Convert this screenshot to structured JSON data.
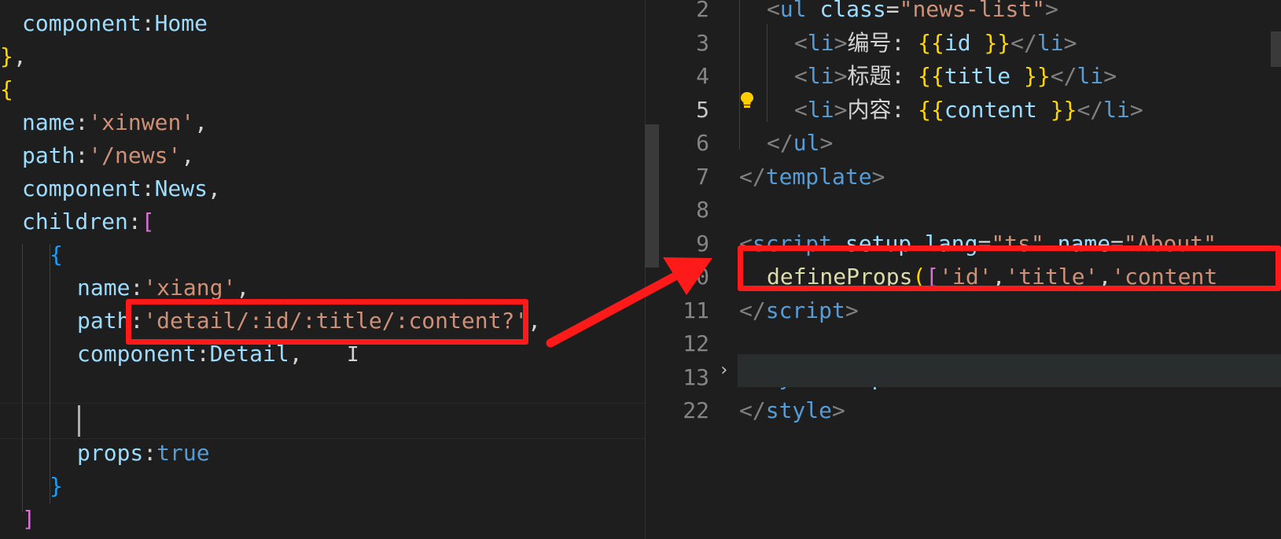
{
  "left_editor": {
    "lines": [
      {
        "indent": 1,
        "tokens": [
          [
            "prop",
            "component"
          ],
          [
            "punc",
            ":"
          ],
          [
            "prop",
            "Home"
          ]
        ]
      },
      {
        "indent": 0,
        "tokens": [
          [
            "brace1",
            "}"
          ],
          [
            "punc",
            ","
          ]
        ]
      },
      {
        "indent": 0,
        "tokens": [
          [
            "brace1",
            "{"
          ]
        ]
      },
      {
        "indent": 1,
        "tokens": [
          [
            "prop",
            "name"
          ],
          [
            "punc",
            ":"
          ],
          [
            "str",
            "'xinwen'"
          ],
          [
            "punc",
            ","
          ]
        ]
      },
      {
        "indent": 1,
        "tokens": [
          [
            "prop",
            "path"
          ],
          [
            "punc",
            ":"
          ],
          [
            "str",
            "'/news'"
          ],
          [
            "punc",
            ","
          ]
        ]
      },
      {
        "indent": 1,
        "tokens": [
          [
            "prop",
            "component"
          ],
          [
            "punc",
            ":"
          ],
          [
            "prop",
            "News"
          ],
          [
            "punc",
            ","
          ]
        ]
      },
      {
        "indent": 1,
        "tokens": [
          [
            "prop",
            "children"
          ],
          [
            "punc",
            ":"
          ],
          [
            "brace2",
            "["
          ]
        ]
      },
      {
        "indent": 2,
        "tokens": [
          [
            "brace3",
            "{"
          ]
        ]
      },
      {
        "indent": 3,
        "tokens": [
          [
            "prop",
            "name"
          ],
          [
            "punc",
            ":"
          ],
          [
            "str",
            "'xiang'"
          ],
          [
            "punc",
            ","
          ]
        ]
      },
      {
        "indent": 3,
        "tokens": [
          [
            "prop",
            "path"
          ],
          [
            "punc",
            ":"
          ],
          [
            "str",
            "'detail/:id/:title/:content?'"
          ],
          [
            "punc",
            ","
          ]
        ]
      },
      {
        "indent": 3,
        "tokens": [
          [
            "prop",
            "component"
          ],
          [
            "punc",
            ":"
          ],
          [
            "prop",
            "Detail"
          ],
          [
            "punc",
            ","
          ]
        ]
      },
      {
        "indent": 3,
        "tokens": []
      },
      {
        "indent": 3,
        "tokens": []
      },
      {
        "indent": 3,
        "tokens": [
          [
            "prop",
            "props"
          ],
          [
            "punc",
            ":"
          ],
          [
            "bool",
            "true"
          ]
        ]
      },
      {
        "indent": 2,
        "tokens": [
          [
            "brace3",
            "}"
          ]
        ]
      },
      {
        "indent": 1,
        "tokens": [
          [
            "brace2",
            "]"
          ]
        ]
      }
    ]
  },
  "right_editor": {
    "lines": [
      {
        "num": "2",
        "indent": 1,
        "tokens": [
          [
            "tag",
            "<"
          ],
          [
            "tagname",
            "ul"
          ],
          [
            "punc",
            " "
          ],
          [
            "attr",
            "class"
          ],
          [
            "punc",
            "="
          ],
          [
            "str",
            "\"news-list\""
          ],
          [
            "tag",
            ">"
          ]
        ]
      },
      {
        "num": "3",
        "indent": 2,
        "tokens": [
          [
            "tag",
            "<"
          ],
          [
            "tagname",
            "li"
          ],
          [
            "tag",
            ">"
          ],
          [
            "punc",
            "编号: "
          ],
          [
            "brace1",
            "{{"
          ],
          [
            "prop",
            "id "
          ],
          [
            "brace1",
            "}}"
          ],
          [
            "tag",
            "</"
          ],
          [
            "tagname",
            "li"
          ],
          [
            "tag",
            ">"
          ]
        ]
      },
      {
        "num": "4",
        "indent": 2,
        "tokens": [
          [
            "tag",
            "<"
          ],
          [
            "tagname",
            "li"
          ],
          [
            "tag",
            ">"
          ],
          [
            "punc",
            "标题: "
          ],
          [
            "brace1",
            "{{"
          ],
          [
            "prop",
            "title "
          ],
          [
            "brace1",
            "}}"
          ],
          [
            "tag",
            "</"
          ],
          [
            "tagname",
            "li"
          ],
          [
            "tag",
            ">"
          ]
        ]
      },
      {
        "num": "5",
        "indent": 2,
        "active": true,
        "tokens": [
          [
            "tag",
            "<"
          ],
          [
            "tagname",
            "li"
          ],
          [
            "tag",
            ">"
          ],
          [
            "punc",
            "内容: "
          ],
          [
            "brace1",
            "{{"
          ],
          [
            "prop",
            "content "
          ],
          [
            "brace1",
            "}}"
          ],
          [
            "tag",
            "</"
          ],
          [
            "tagname",
            "li"
          ],
          [
            "tag",
            ">"
          ]
        ]
      },
      {
        "num": "6",
        "indent": 1,
        "tokens": [
          [
            "tag",
            "</"
          ],
          [
            "tagname",
            "ul"
          ],
          [
            "tag",
            ">"
          ]
        ]
      },
      {
        "num": "7",
        "indent": 0,
        "tokens": [
          [
            "tag",
            "</"
          ],
          [
            "tagname",
            "template"
          ],
          [
            "tag",
            ">"
          ]
        ]
      },
      {
        "num": "8",
        "indent": 0,
        "tokens": []
      },
      {
        "num": "9",
        "indent": 0,
        "tokens": [
          [
            "tag",
            "<"
          ],
          [
            "tagname",
            "script"
          ],
          [
            "punc",
            " "
          ],
          [
            "attr",
            "setup"
          ],
          [
            "punc",
            " "
          ],
          [
            "attr",
            "lang"
          ],
          [
            "punc",
            "="
          ],
          [
            "str",
            "\"ts\""
          ],
          [
            "punc",
            " "
          ],
          [
            "attr",
            "name"
          ],
          [
            "punc",
            "="
          ],
          [
            "str",
            "\"About\""
          ]
        ]
      },
      {
        "num": "10",
        "indent": 1,
        "tokens": [
          [
            "fn",
            "defineProps"
          ],
          [
            "brace1",
            "("
          ],
          [
            "brace2",
            "["
          ],
          [
            "str",
            "'id'"
          ],
          [
            "punc",
            ","
          ],
          [
            "str",
            "'title'"
          ],
          [
            "punc",
            ","
          ],
          [
            "str",
            "'content"
          ]
        ]
      },
      {
        "num": "11",
        "indent": 0,
        "tokens": [
          [
            "tag",
            "</"
          ],
          [
            "tagname",
            "script"
          ],
          [
            "tag",
            ">"
          ]
        ]
      },
      {
        "num": "12",
        "indent": 0,
        "tokens": []
      },
      {
        "num": "13",
        "indent": 0,
        "folded": true,
        "tokens": [
          [
            "tag",
            "<"
          ],
          [
            "tagname",
            "style"
          ],
          [
            "punc",
            " "
          ],
          [
            "attr",
            "scoped"
          ],
          [
            "tag",
            ">"
          ],
          [
            "ellipsis",
            " ⋯"
          ]
        ]
      },
      {
        "num": "22",
        "indent": 0,
        "tokens": [
          [
            "tag",
            "</"
          ],
          [
            "tagname",
            "style"
          ],
          [
            "tag",
            ">"
          ]
        ]
      }
    ]
  },
  "icons": {
    "lightbulb": "lightbulb-icon",
    "fold": "chevron-right-icon",
    "text_cursor": "ibeam-cursor-icon"
  },
  "annotation_color": "#ff1a1a"
}
